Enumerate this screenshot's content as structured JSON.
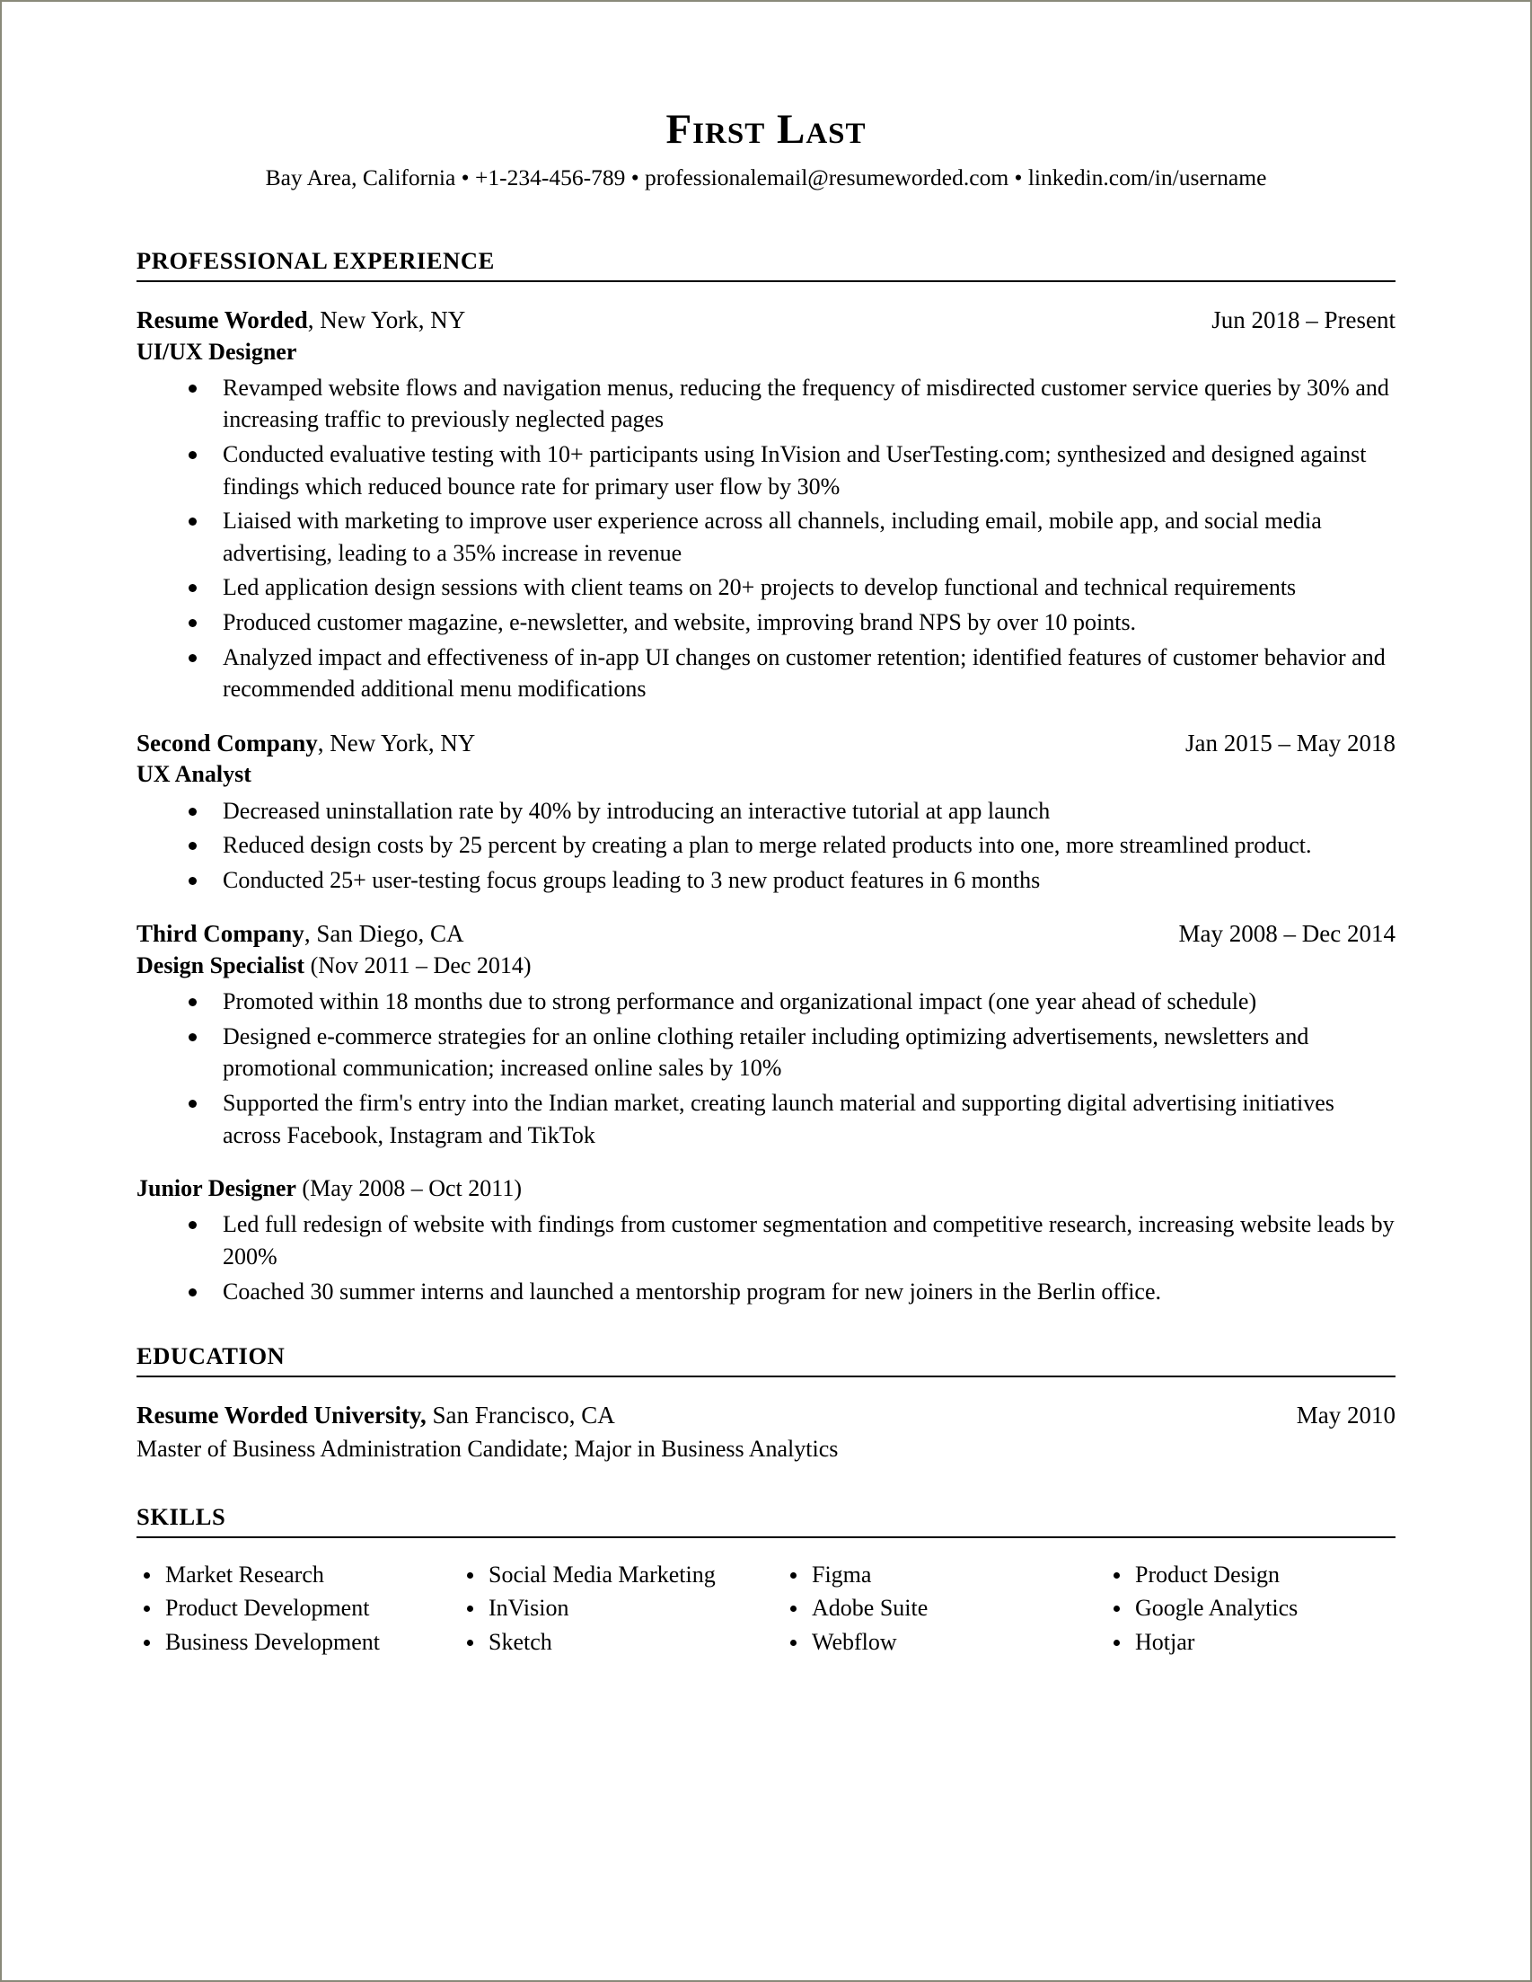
{
  "header": {
    "name": "First Last",
    "contact": "Bay Area, California • +1-234-456-789 • professionalemail@resumeworded.com • linkedin.com/in/username"
  },
  "sections": {
    "experience": {
      "title": "PROFESSIONAL EXPERIENCE",
      "entries": [
        {
          "company": "Resume Worded",
          "location": ", New York, NY",
          "dates": "Jun 2018 – Present",
          "role": "UI/UX Designer",
          "role_dates": "",
          "bullets": [
            "Revamped website flows and navigation menus, reducing the frequency of misdirected customer service queries by 30% and increasing traffic to previously neglected pages",
            "Conducted evaluative testing with 10+ participants using InVision and UserTesting.com; synthesized and designed against findings which reduced bounce rate for primary user flow by 30%",
            "Liaised with marketing to improve user experience across all channels, including email, mobile app, and social media advertising, leading to a 35% increase in revenue",
            "Led application design sessions with client teams on 20+ projects to develop functional and technical requirements",
            "Produced customer magazine, e-newsletter, and website, improving brand NPS by over 10 points.",
            "Analyzed impact and effectiveness of in-app UI changes on customer retention; identified features of customer behavior and recommended additional menu modifications"
          ]
        },
        {
          "company": "Second Company",
          "location": ", New York, NY",
          "dates": "Jan 2015 – May 2018",
          "role": "UX Analyst",
          "role_dates": "",
          "bullets": [
            "Decreased uninstallation rate by 40% by introducing an interactive tutorial at app launch",
            "Reduced design costs by 25 percent by creating a plan to merge related products into one, more streamlined product.",
            "Conducted 25+ user-testing focus groups leading to 3 new product features in 6 months"
          ]
        },
        {
          "company": "Third Company",
          "location": ", San Diego, CA",
          "dates": "May 2008 – Dec 2014",
          "role": "Design Specialist",
          "role_dates": " (Nov 2011 – Dec 2014)",
          "bullets": [
            "Promoted within 18 months due to strong performance and organizational impact (one year ahead of schedule)",
            "Designed e-commerce strategies for an online clothing retailer including optimizing advertisements, newsletters and promotional communication; increased online sales by 10%",
            "Supported the firm's entry into the Indian market, creating launch material and supporting digital advertising initiatives across Facebook, Instagram and TikTok"
          ]
        },
        {
          "company": "",
          "location": "",
          "dates": "",
          "role": "Junior Designer",
          "role_dates": " (May 2008 – Oct 2011)",
          "bullets": [
            "Led full redesign of website with findings from customer segmentation and competitive research, increasing website leads by 200%",
            "Coached 30 summer interns and launched a mentorship program for new joiners in the Berlin office."
          ]
        }
      ]
    },
    "education": {
      "title": "EDUCATION",
      "school": "Resume Worded University,",
      "location": " San Francisco, CA",
      "dates": "May 2010",
      "degree": "Master of Business Administration Candidate; Major in Business Analytics"
    },
    "skills": {
      "title": "SKILLS",
      "items": [
        "Market Research",
        "Social Media Marketing",
        "Figma",
        "Product Design",
        "Product Development",
        "InVision",
        "Adobe Suite",
        "Google Analytics",
        "Business Development",
        "Sketch",
        "Webflow",
        "Hotjar"
      ]
    }
  }
}
